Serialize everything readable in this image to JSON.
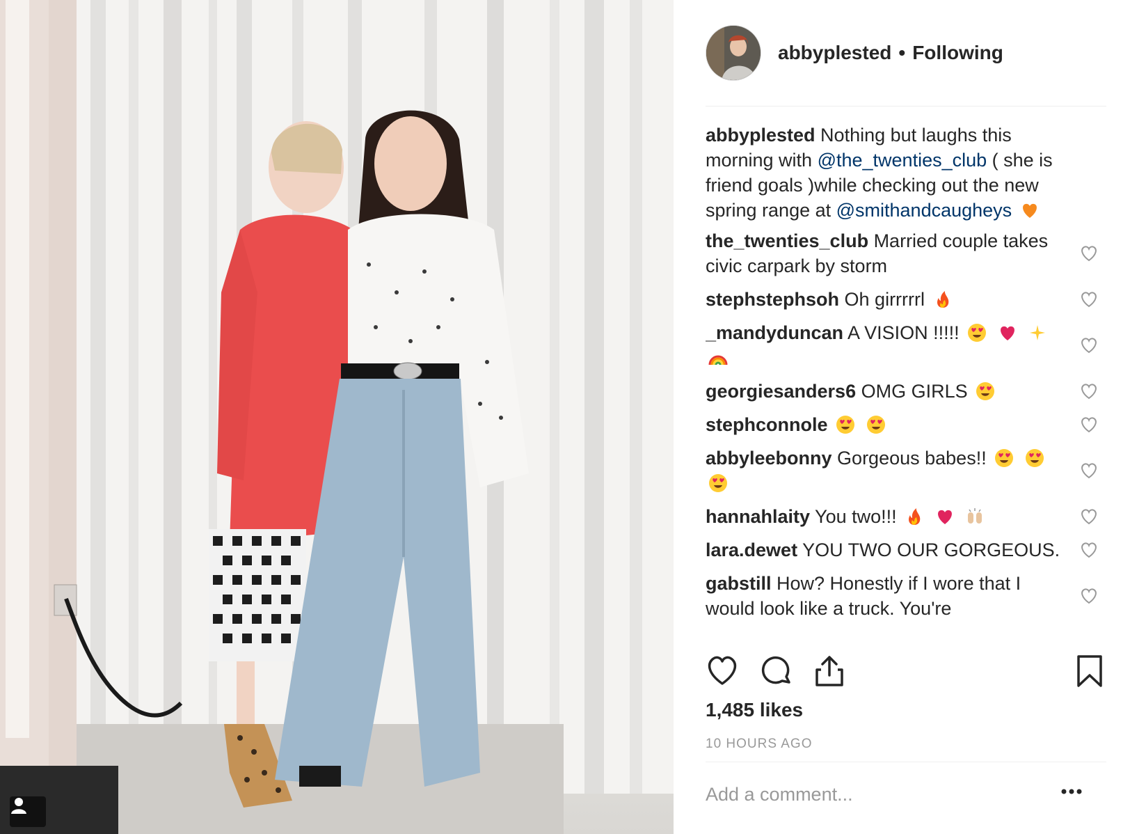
{
  "post": {
    "username": "abbyplested",
    "separator": "•",
    "follow_status": "Following",
    "caption": {
      "username": "abbyplested",
      "text_1": " Nothing but laughs this morning with ",
      "mention_1": "@the_twenties_club",
      "text_2": " ( she is friend goals )while checking out the new spring range at ",
      "mention_2": "@smithandcaugheys",
      "emoji": "orange-heart"
    },
    "comments": [
      {
        "username": "the_twenties_club",
        "text": " Married couple takes civic carpark by storm",
        "emojis": []
      },
      {
        "username": "stephstephsoh",
        "text": " Oh girrrrrl",
        "emojis": [
          "fire"
        ]
      },
      {
        "username": "_mandyduncan",
        "text": " A VISION !!!!!",
        "emojis": [
          "heart-eyes",
          "red-heart",
          "sparkles",
          "rainbow"
        ]
      },
      {
        "username": "georgiesanders6",
        "text": " OMG GIRLS",
        "emojis": [
          "heart-eyes"
        ]
      },
      {
        "username": "stephconnole",
        "text": " ",
        "emojis": [
          "heart-eyes",
          "heart-eyes"
        ]
      },
      {
        "username": "abbyleebonny",
        "text": " Gorgeous babes!!",
        "emojis": [
          "heart-eyes",
          "heart-eyes",
          "heart-eyes"
        ]
      },
      {
        "username": "hannahlaity",
        "text": " You two!!!",
        "emojis": [
          "fire",
          "red-heart",
          "raised-hands"
        ]
      },
      {
        "username": "lara.dewet",
        "text": " YOU TWO OUR GORGEOUS.",
        "emojis": []
      },
      {
        "username": "gabstill",
        "text": " How? Honestly if I wore that I would look like a truck. You're",
        "emojis": []
      }
    ],
    "likes": "1,485 likes",
    "time_ago": "10 HOURS AGO",
    "add_comment_placeholder": "Add a comment...",
    "icons": {
      "like": "heart-icon",
      "comment": "comment-bubble-icon",
      "share": "share-icon",
      "save": "bookmark-icon",
      "more": "more-dots-icon",
      "tag": "user-tag-icon"
    },
    "colors": {
      "text": "#262626",
      "mention": "#003569",
      "muted": "#999999",
      "divider": "#efefef"
    }
  }
}
